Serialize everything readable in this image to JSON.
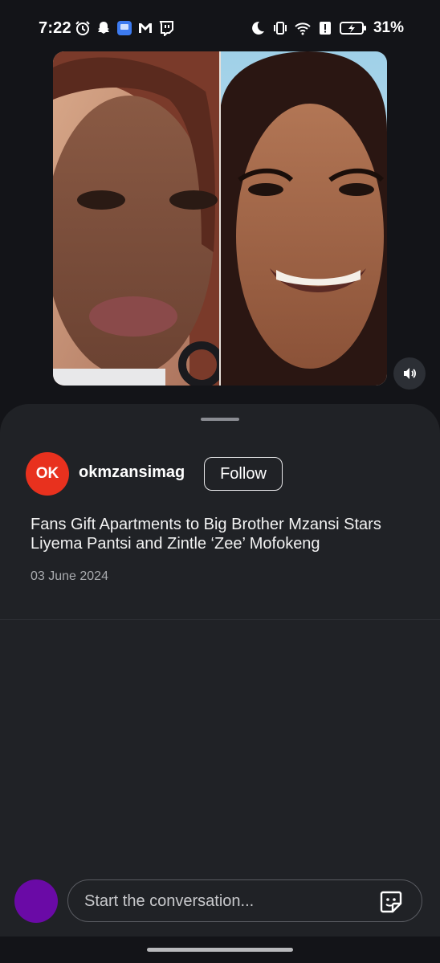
{
  "status_bar": {
    "time": "7:22",
    "battery_percent": "31%",
    "left_icons": [
      "alarm-icon",
      "snapchat-icon",
      "app-icon",
      "gmail-icon",
      "twitch-icon"
    ],
    "right_icons": [
      "moon-icon",
      "vibrate-icon",
      "wifi-icon",
      "alert-icon",
      "battery-icon"
    ]
  },
  "post": {
    "media_icons": [
      "volume-icon"
    ],
    "account": {
      "logo_text": "OK",
      "username": "okmzansimag",
      "follow_label": "Follow",
      "brand_color": "#e8311e"
    },
    "headline": "Fans Gift Apartments to Big Brother Mzansi Stars Liyema Pantsi and Zintle ‘Zee’ Mofokeng",
    "date": "03 June 2024"
  },
  "composer": {
    "placeholder": "Start the conversation...",
    "avatar_color": "#6a0aa6",
    "icon": "sticker-icon"
  }
}
